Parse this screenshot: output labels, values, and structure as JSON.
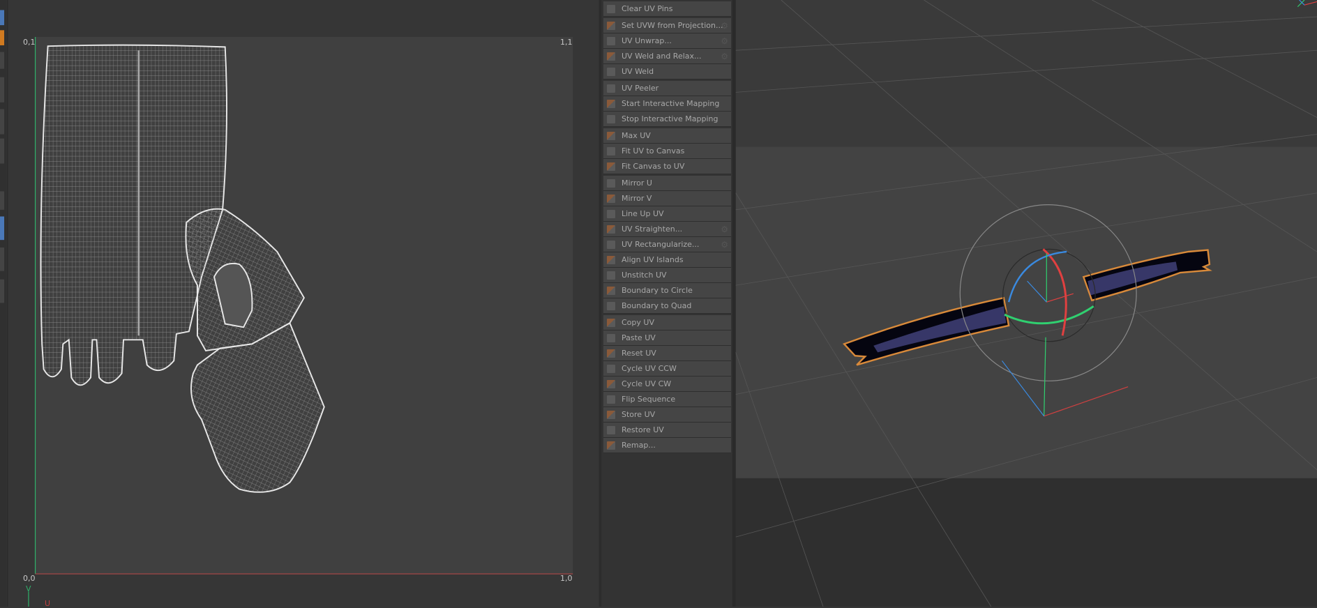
{
  "uv_editor": {
    "corner_labels": {
      "top_left": "0,1",
      "top_right": "1,1",
      "bottom_left": "0,0",
      "bottom_right": "1,0"
    },
    "axis_labels": {
      "v": "V",
      "u": "U"
    },
    "colors": {
      "v_axis": "#2fb06a",
      "u_axis": "#9a4545",
      "canvas": "#404040",
      "island_outline": "#e8e8e8"
    }
  },
  "uv_commands": {
    "groups": [
      [
        {
          "label": "Clear UV Pins",
          "icon": "pin-icon"
        }
      ],
      [
        {
          "label": "Set UVW from Projection...",
          "icon": "projection-icon",
          "gear": true
        },
        {
          "label": "UV Unwrap...",
          "icon": "unwrap-icon",
          "gear": true
        },
        {
          "label": "UV Weld and Relax...",
          "icon": "weld-relax-icon",
          "gear": true
        },
        {
          "label": "UV Weld",
          "icon": "weld-icon"
        }
      ],
      [
        {
          "label": "UV Peeler",
          "icon": "peeler-icon"
        },
        {
          "label": "Start Interactive Mapping",
          "icon": "interactive-mapping-icon"
        },
        {
          "label": "Stop Interactive Mapping",
          "icon": "stop-mapping-icon"
        }
      ],
      [
        {
          "label": "Max UV",
          "icon": "max-uv-icon"
        },
        {
          "label": "Fit UV to Canvas",
          "icon": "fit-uv-icon"
        },
        {
          "label": "Fit Canvas to UV",
          "icon": "fit-canvas-icon"
        }
      ],
      [
        {
          "label": "Mirror U",
          "icon": "mirror-u-icon"
        },
        {
          "label": "Mirror V",
          "icon": "mirror-v-icon"
        },
        {
          "label": "Line Up UV",
          "icon": "line-up-icon"
        },
        {
          "label": "UV Straighten...",
          "icon": "straighten-icon",
          "gear": true
        },
        {
          "label": "UV Rectangularize...",
          "icon": "rectangularize-icon",
          "gear": true
        },
        {
          "label": "Align UV Islands",
          "icon": "align-islands-icon"
        },
        {
          "label": "Unstitch UV",
          "icon": "unstitch-icon"
        },
        {
          "label": "Boundary to Circle",
          "icon": "boundary-circle-icon"
        },
        {
          "label": "Boundary to Quad",
          "icon": "boundary-quad-icon"
        }
      ],
      [
        {
          "label": "Copy UV",
          "icon": "copy-icon"
        },
        {
          "label": "Paste UV",
          "icon": "paste-icon"
        },
        {
          "label": "Reset UV",
          "icon": "reset-icon"
        },
        {
          "label": "Cycle UV CCW",
          "icon": "cycle-ccw-icon"
        },
        {
          "label": "Cycle UV CW",
          "icon": "cycle-cw-icon"
        },
        {
          "label": "Flip Sequence",
          "icon": "flip-icon"
        },
        {
          "label": "Store UV",
          "icon": "store-icon"
        },
        {
          "label": "Restore UV",
          "icon": "restore-icon"
        },
        {
          "label": "Remap...",
          "icon": "remap-icon"
        }
      ]
    ]
  },
  "viewport": {
    "colors": {
      "selection_outline": "#d98a3a",
      "x_axis": "#e04040",
      "y_axis": "#30d070",
      "z_axis": "#3a8ae0"
    }
  }
}
